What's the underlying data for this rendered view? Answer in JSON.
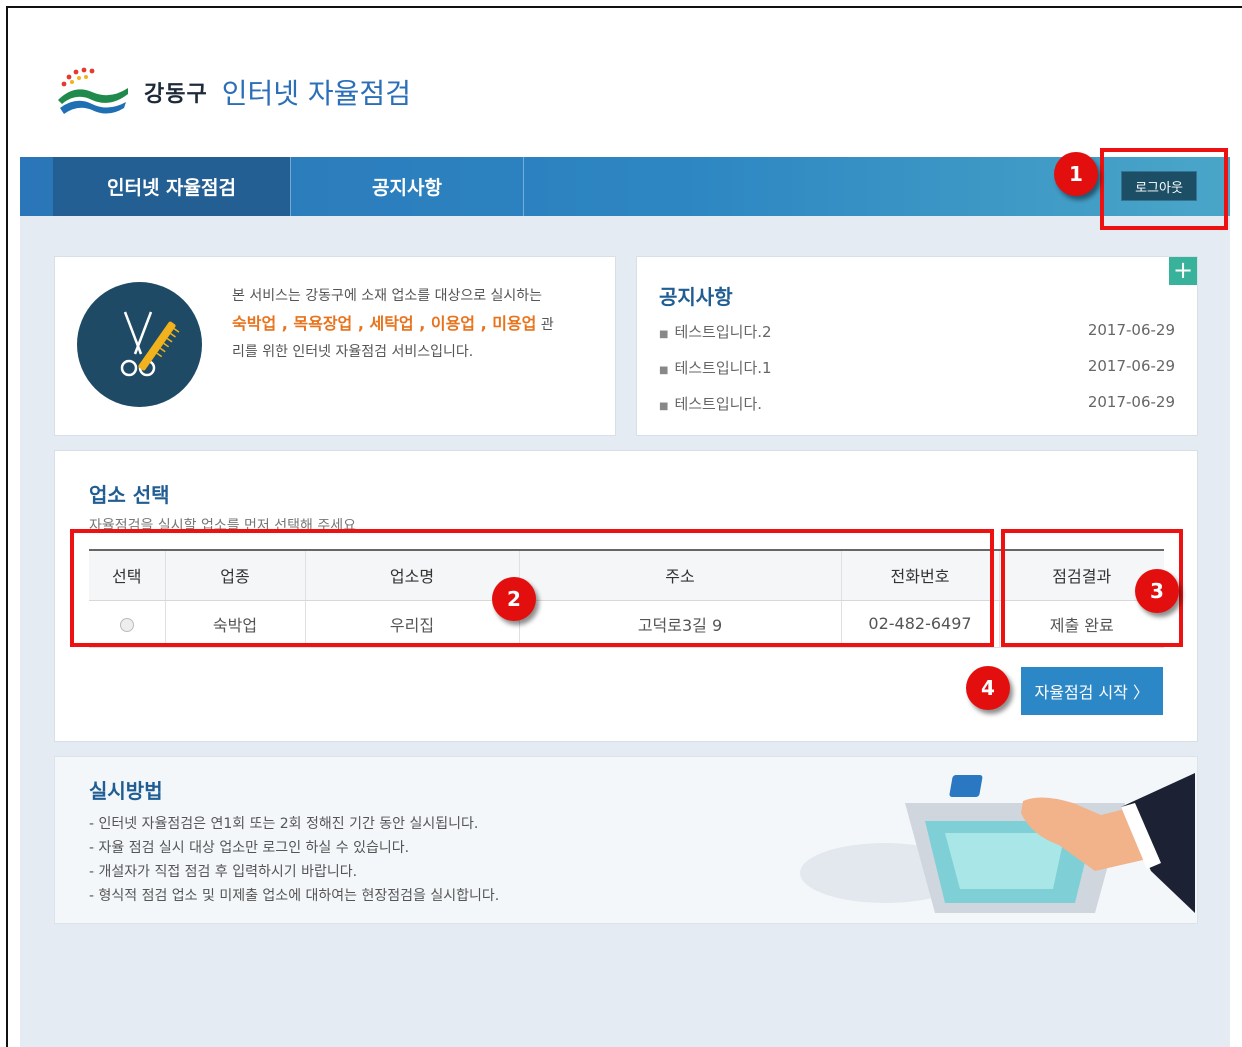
{
  "header": {
    "org_name": "강동구",
    "service_name": "인터넷 자율점검"
  },
  "nav": {
    "tabs": [
      {
        "label": "인터넷 자율점검",
        "active": true
      },
      {
        "label": "공지사항",
        "active": false
      }
    ],
    "logout_label": "로그아웃"
  },
  "intro": {
    "line1": "본 서비스는 강동구에 소재 업소를 대상으로 실시하는",
    "highlight": "숙박업 , 목욕장업 , 세탁업 , 이용업 , 미용업",
    "line2_suffix": " 관",
    "line3": "리를 위한 인터넷 자율점검 서비스입니다.",
    "icon": "scissors-comb-icon"
  },
  "notice": {
    "title": "공지사항",
    "more_label": "+",
    "items": [
      {
        "title": "테스트입니다.2",
        "date": "2017-06-29"
      },
      {
        "title": "테스트입니다.1",
        "date": "2017-06-29"
      },
      {
        "title": "테스트입니다.",
        "date": "2017-06-29"
      }
    ]
  },
  "select": {
    "title": "업소 선택",
    "description": "자율점검을 실시할 업소를 먼저 선택해 주세요",
    "columns": [
      "선택",
      "업종",
      "업소명",
      "주소",
      "전화번호",
      "점검결과"
    ],
    "rows": [
      {
        "type": "숙박업",
        "name": "우리집",
        "address": "고덕로3길 9",
        "phone": "02-482-6497",
        "result": "제출 완료"
      }
    ],
    "start_label": "자율점검 시작 〉"
  },
  "method": {
    "title": "실시방법",
    "lines": [
      "- 인터넷 자율점검은 연1회 또는 2회 정해진 기간 동안 실시됩니다.",
      "- 자율 점검 실시 대상 업소만 로그인 하실 수 있습니다.",
      "- 개설자가 직접 점검 후 입력하시기 바랍니다.",
      "- 형식적 점검 업소 및 미제출 업소에 대하여는 현장점검을 실시합니다."
    ]
  },
  "annotations": [
    "1",
    "2",
    "3",
    "4"
  ],
  "colors": {
    "accent": "#2a76b8",
    "highlight": "#e8731c",
    "annotation": "#e30f0f"
  }
}
